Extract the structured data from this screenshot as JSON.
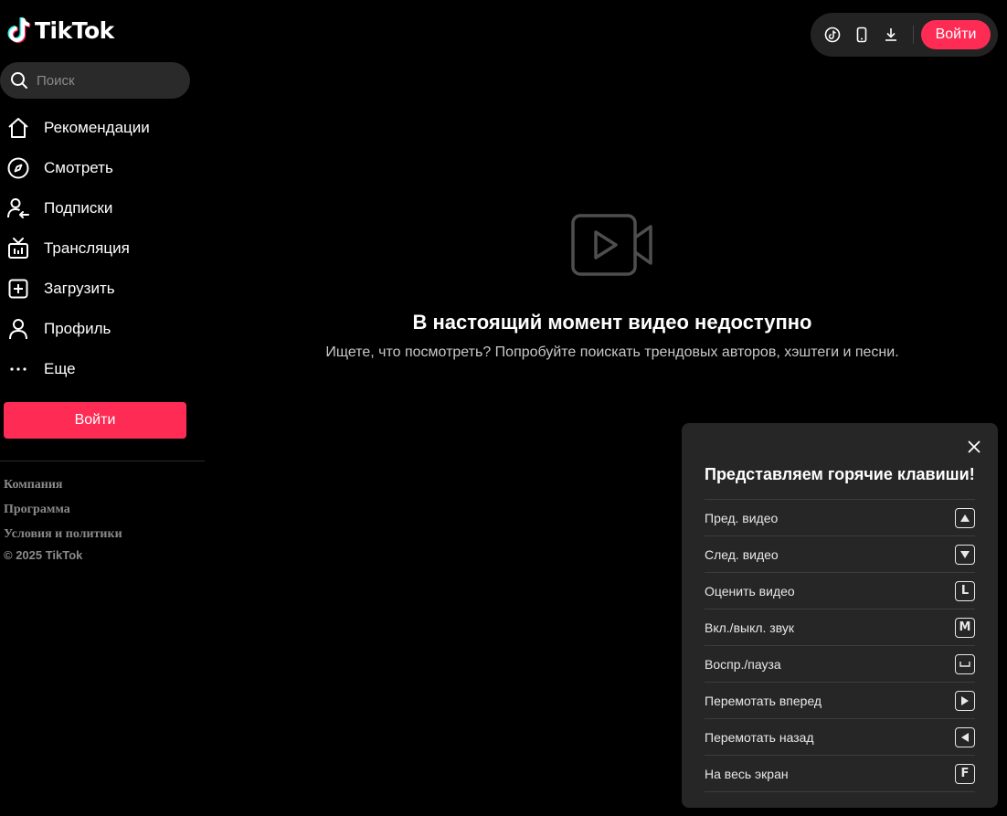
{
  "brand": {
    "name": "TikTok",
    "accent": "#fe2c55"
  },
  "search": {
    "placeholder": "Поиск"
  },
  "nav": [
    {
      "label": "Рекомендации",
      "icon": "home-icon"
    },
    {
      "label": "Смотреть",
      "icon": "compass-icon"
    },
    {
      "label": "Подписки",
      "icon": "following-icon"
    },
    {
      "label": "Трансляция",
      "icon": "live-tv-icon"
    },
    {
      "label": "Загрузить",
      "icon": "upload-icon"
    },
    {
      "label": "Профиль",
      "icon": "profile-icon"
    },
    {
      "label": "Еще",
      "icon": "more-icon"
    }
  ],
  "sidebar": {
    "login_label": "Войти",
    "footer_links": [
      "Компания",
      "Программа",
      "Условия и политики"
    ],
    "copyright": "© 2025 TikTok"
  },
  "topbar": {
    "icons": [
      "tiktok-coin-icon",
      "mobile-app-icon",
      "download-icon"
    ],
    "login_label": "Войти"
  },
  "main": {
    "title": "В настоящий момент видео недоступно",
    "subtitle": "Ищете, что посмотреть? Попробуйте поискать трендовых авторов, хэштеги и песни."
  },
  "shortcuts": {
    "title": "Представляем горячие клавиши!",
    "items": [
      {
        "label": "Пред. видео",
        "key": "▲"
      },
      {
        "label": "След. видео",
        "key": "▼"
      },
      {
        "label": "Оценить видео",
        "key": "L"
      },
      {
        "label": "Вкл./выкл. звук",
        "key": "M"
      },
      {
        "label": "Воспр./пауза",
        "key": "␣"
      },
      {
        "label": "Перемотать вперед",
        "key": "▶"
      },
      {
        "label": "Перемотать назад",
        "key": "◀"
      },
      {
        "label": "На весь экран",
        "key": "F"
      }
    ]
  }
}
